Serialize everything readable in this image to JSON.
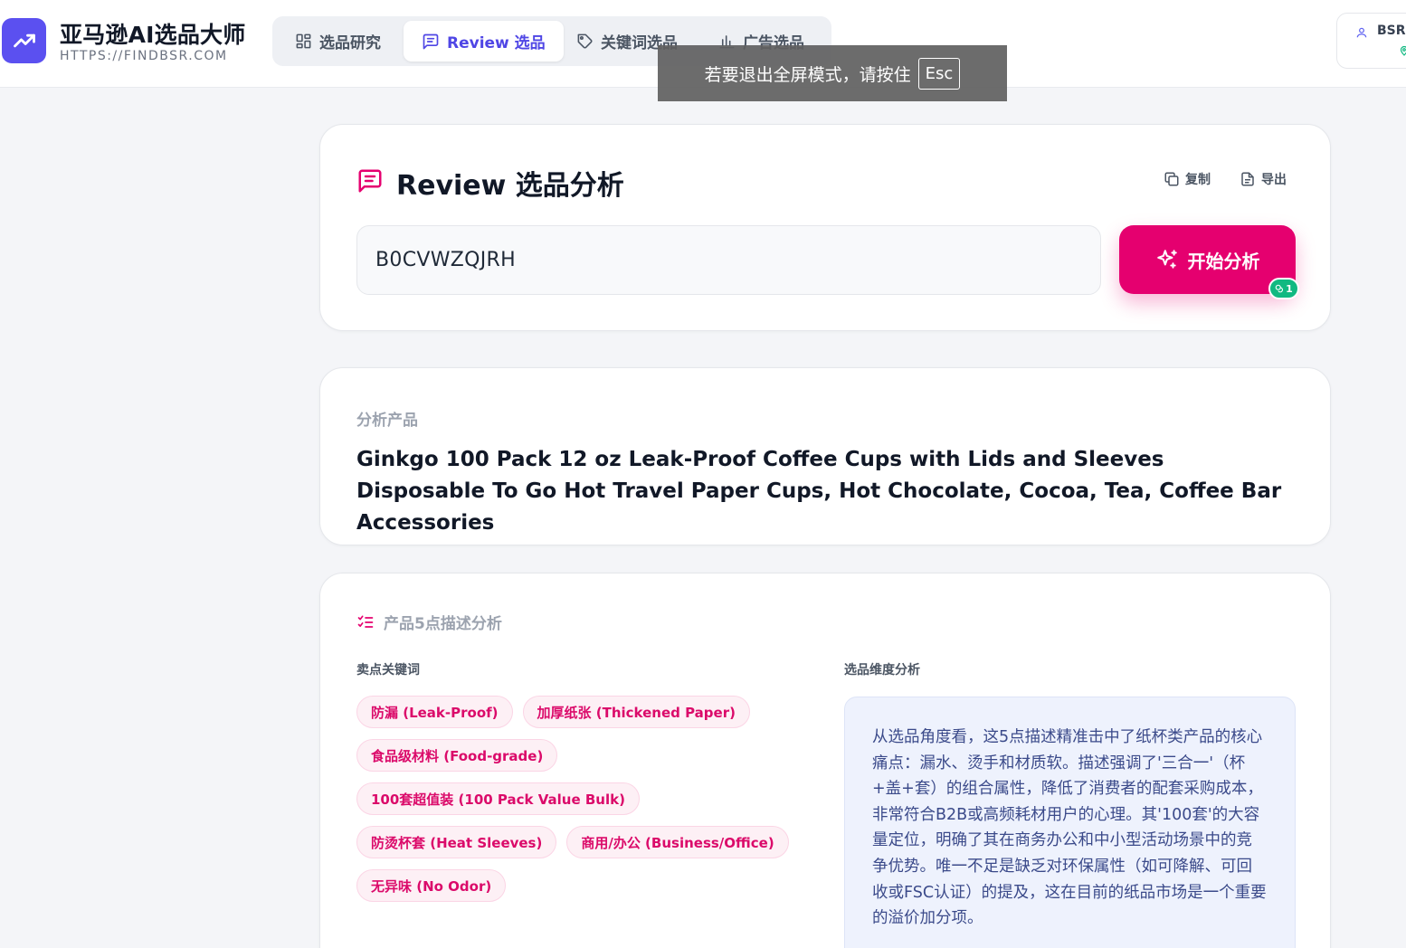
{
  "brand": {
    "title": "亚马逊AI选品大师",
    "url": "HTTPS://FINDBSR.COM"
  },
  "nav": {
    "tabs": [
      {
        "label": "选品研究",
        "icon": "grid-icon",
        "active": false
      },
      {
        "label": "Review 选品",
        "icon": "message-square-icon",
        "active": true
      },
      {
        "label": "关键词选品",
        "icon": "tag-icon",
        "active": false
      },
      {
        "label": "广告选品",
        "icon": "bar-chart-icon",
        "active": false
      }
    ]
  },
  "user": {
    "label": "BSR-"
  },
  "toast": {
    "text": "若要退出全屏模式，请按住",
    "key": "Esc"
  },
  "review_card": {
    "title": "Review 选品分析",
    "copy_label": "复制",
    "export_label": "导出",
    "asin_value": "B0CVWZQJRH",
    "start_label": "开始分析",
    "badge_count": "1"
  },
  "product_card": {
    "label": "分析产品",
    "title": "Ginkgo 100 Pack 12 oz Leak-Proof Coffee Cups with Lids and Sleeves Disposable To Go Hot Travel Paper Cups, Hot Chocolate, Cocoa, Tea, Coffee Bar Accessories"
  },
  "analysis_card": {
    "heading": "产品5点描述分析",
    "keywords_label": "卖点关键词",
    "dimension_label": "选品维度分析",
    "keywords": [
      "防漏 (Leak-Proof)",
      "加厚纸张 (Thickened Paper)",
      "食品级材料 (Food-grade)",
      "100套超值装 (100 Pack Value Bulk)",
      "防烫杯套 (Heat Sleeves)",
      "商用/办公 (Business/Office)",
      "无异味 (No Odor)"
    ],
    "analysis_text": "从选品角度看，这5点描述精准击中了纸杯类产品的核心痛点：漏水、烫手和材质软。描述强调了'三合一'（杯+盖+套）的组合属性，降低了消费者的配套采购成本，非常符合B2B或高频耗材用户的心理。其'100套'的大容量定位，明确了其在商务办公和中小型活动场景中的竞争优势。唯一不足是缺乏对环保属性（如可降解、可回收或FSC认证）的提及，这在目前的纸品市场是一个重要的溢价加分项。"
  },
  "colors": {
    "brand": "#5b50f0",
    "accent": "#e5006f",
    "badge": "#10b981",
    "tag_text": "#db0a6a"
  }
}
